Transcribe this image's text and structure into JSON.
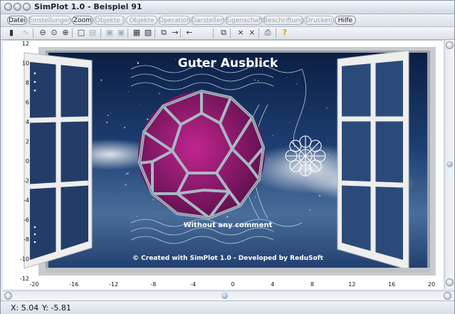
{
  "window": {
    "title": "SimPlot 1.0 - Beispiel 91"
  },
  "menu": [
    {
      "label": "Datei",
      "enabled": true
    },
    {
      "label": "Einstellungen",
      "enabled": false
    },
    {
      "label": "Zoom",
      "enabled": true
    },
    {
      "label": "Objekte I",
      "enabled": false
    },
    {
      "label": "Objekte II",
      "enabled": false
    },
    {
      "label": "Operation",
      "enabled": false
    },
    {
      "label": "Darstellen",
      "enabled": false
    },
    {
      "label": "Eigenschaft",
      "enabled": false
    },
    {
      "label": "Beschriftung",
      "enabled": false
    },
    {
      "label": "Drucken",
      "enabled": false
    },
    {
      "label": "Hilfe",
      "enabled": true
    }
  ],
  "toolbar": [
    {
      "icon": "calculator-icon",
      "glyph": "▮",
      "enabled": true
    },
    {
      "icon": "function-icon",
      "glyph": "∿",
      "enabled": false
    },
    {
      "icon": "zoom-out-icon",
      "glyph": "⊖",
      "enabled": true
    },
    {
      "icon": "zoom-icon",
      "glyph": "⊙",
      "enabled": true
    },
    {
      "icon": "zoom-in-icon",
      "glyph": "⊕",
      "enabled": true
    },
    {
      "icon": "rectangle-icon",
      "glyph": "□",
      "enabled": true
    },
    {
      "icon": "grid-icon",
      "glyph": "▤",
      "enabled": false
    },
    {
      "icon": "frame-icon",
      "glyph": "▣",
      "enabled": false
    },
    {
      "icon": "frame-2-icon",
      "glyph": "▣",
      "enabled": false
    },
    {
      "icon": "table-icon",
      "glyph": "▦",
      "enabled": true
    },
    {
      "icon": "image-icon",
      "glyph": "▨",
      "enabled": true
    },
    {
      "icon": "copy-icon",
      "glyph": "⧉",
      "enabled": true
    },
    {
      "icon": "arrow-right-icon",
      "glyph": "→",
      "enabled": true
    },
    {
      "icon": "arrow-left-icon",
      "glyph": "←",
      "enabled": true
    },
    {
      "icon": "pages-icon",
      "glyph": "⧉",
      "enabled": true
    },
    {
      "icon": "cross-icon",
      "glyph": "⨯",
      "enabled": true
    },
    {
      "icon": "cross-2-icon",
      "glyph": "⨯",
      "enabled": true
    },
    {
      "icon": "print-icon",
      "glyph": "⎙",
      "enabled": true
    },
    {
      "icon": "help-icon",
      "glyph": "?",
      "enabled": true
    }
  ],
  "plot": {
    "x_ticks": [
      "-20",
      "-16",
      "-12",
      "-8",
      "-4",
      "0",
      "4",
      "8",
      "12",
      "16",
      "20"
    ],
    "y_ticks": [
      "12",
      "10",
      "8",
      "6",
      "4",
      "2",
      "0",
      "-2",
      "-4",
      "-6",
      "-8",
      "-10",
      "-12"
    ],
    "xlim": [
      -20,
      20
    ],
    "ylim": [
      -12,
      12
    ],
    "heading": "Guter Ausblick",
    "caption": "Without any comment",
    "credit": "© Created with SimPlot 1.0 - Developed by ReduSoft",
    "colors": {
      "sky": "#1c3a6b",
      "polyhedron_face": "#8e1a72",
      "polyhedron_edge": "#a9b7c4",
      "frame": "#ededee"
    }
  },
  "status": {
    "x_label": "X: 5.04",
    "y_label": "Y: -5.81"
  }
}
